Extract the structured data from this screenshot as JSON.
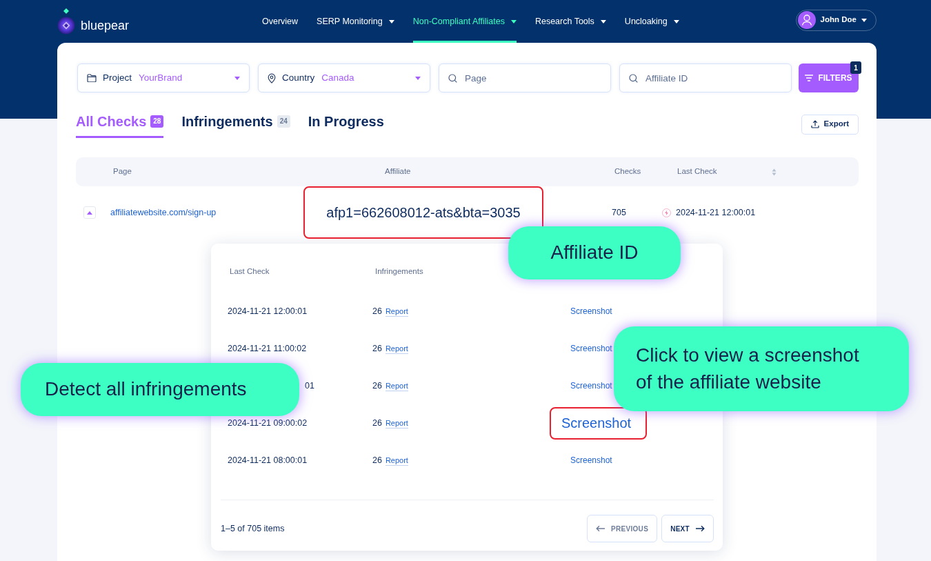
{
  "brand": {
    "name": "bluepear"
  },
  "nav": [
    {
      "label": "Overview",
      "dropdown": false,
      "selected": false
    },
    {
      "label": "SERP Monitoring",
      "dropdown": true,
      "selected": false
    },
    {
      "label": "Non-Compliant Affiliates",
      "dropdown": true,
      "selected": true
    },
    {
      "label": "Research Tools",
      "dropdown": true,
      "selected": false
    },
    {
      "label": "Uncloaking",
      "dropdown": true,
      "selected": false
    }
  ],
  "user": {
    "name": "John Doe"
  },
  "filters": [
    {
      "kind": "project",
      "label": "Project",
      "value": "YourBrand"
    },
    {
      "kind": "country",
      "label": "Country",
      "value": "Canada"
    },
    {
      "kind": "search",
      "placeholder": "Page"
    },
    {
      "kind": "search",
      "placeholder": "Affiliate ID"
    }
  ],
  "filters_button": {
    "label": "FILTERS",
    "count": "1"
  },
  "tabs": [
    {
      "label": "All Checks",
      "count": "28",
      "selected": true
    },
    {
      "label": "Infringements",
      "count": "24",
      "selected": false
    },
    {
      "label": "In Progress",
      "selected": false
    }
  ],
  "export_button": {
    "label": "Export"
  },
  "table": {
    "columns": [
      "Page",
      "Affiliate",
      "Checks",
      "Last Check"
    ],
    "rows": [
      {
        "page": "affiliatewebsite.com/sign-up",
        "affiliate": "afp1=662608012-ats&bta=3035",
        "highlighted": true,
        "checks": "705",
        "last_check": "2024-11-21 12:00:01",
        "expanded": true
      }
    ]
  },
  "detail": {
    "columns": [
      "Last Check",
      "Infringements"
    ],
    "rows": [
      {
        "last_check": "2024-11-21 12:00:01",
        "cut": false,
        "infringements": "26",
        "report": "Report",
        "screenshot": "Screenshot",
        "highlighted": false
      },
      {
        "last_check": "2024-11-21 11:00:02",
        "cut": false,
        "infringements": "26",
        "report": "Report",
        "screenshot": "Screenshot",
        "highlighted": false
      },
      {
        "last_check": "01",
        "cut": true,
        "infringements": "26",
        "report": "Report",
        "screenshot": "Screenshot",
        "highlighted": false
      },
      {
        "last_check": "2024-11-21 09:00:02",
        "cut": false,
        "infringements": "26",
        "report": "Report",
        "screenshot": "Screenshot",
        "highlighted": true
      },
      {
        "last_check": "2024-11-21 08:00:01",
        "cut": false,
        "infringements": "26",
        "report": "Report",
        "screenshot": "Screenshot",
        "highlighted": false
      }
    ],
    "summary": "1–5 of 705 items",
    "previous": {
      "label": "PREVIOUS",
      "disabled": true
    },
    "next": {
      "label": "NEXT",
      "disabled": false
    }
  },
  "callouts": [
    {
      "text": "Affiliate ID"
    },
    {
      "text": "Detect all infringements"
    },
    {
      "text": "Click to view a screenshot of the affiliate website"
    }
  ]
}
